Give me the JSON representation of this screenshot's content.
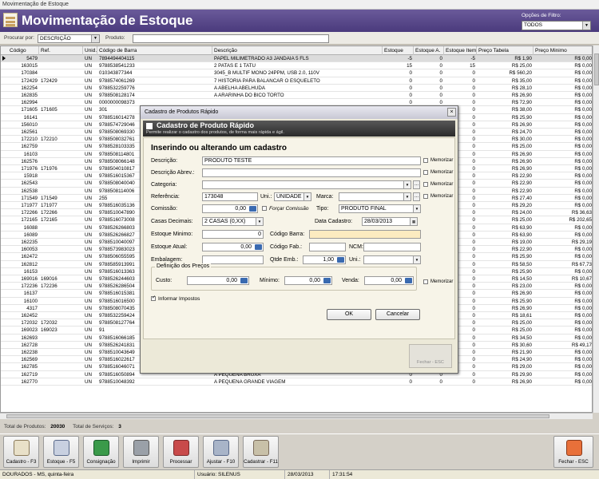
{
  "window": {
    "title": "Movimentação de Estoque"
  },
  "header": {
    "title": "Movimentação de Estoque",
    "filter_label": "Opções de Filtro:",
    "filter_value": "TODOS"
  },
  "search": {
    "by_label": "Procurar por:",
    "by_value": "DESCRIÇÃO",
    "product_label": "Produto:",
    "product_value": ""
  },
  "grid": {
    "columns": [
      "Código",
      "Ref.",
      "Unid.",
      "Código de Barra",
      "Descrição",
      "Estoque",
      "Estoque A.",
      "Estoque Item",
      "Preço Tabela",
      "Preço Minimo"
    ],
    "rows": [
      [
        "5479",
        "",
        "UN",
        "7894494404115",
        "PAPEL MILIMETRADO A3 JANDAIA 5 FLS",
        "-5",
        "0",
        "-5",
        "R$ 1,90",
        "R$ 0,00"
      ],
      [
        "163015",
        "",
        "UN",
        "9788538541233",
        "2 PATAS E 1 TATU",
        "15",
        "0",
        "15",
        "R$ 25,00",
        "R$ 0,00"
      ],
      [
        "170384",
        "",
        "UN",
        "010343877344",
        "3045_B MULTIF MONO 24PPM, USB 2.0, 110V",
        "0",
        "0",
        "0",
        "R$ 560,20",
        "R$ 0,00"
      ],
      [
        "172429",
        "172429",
        "UN",
        "9788574061269",
        "7 HISTORIA PARA BALANCAR O ESQUELETO",
        "0",
        "0",
        "0",
        "R$ 35,00",
        "R$ 0,00"
      ],
      [
        "162254",
        "",
        "UN",
        "9788532259776",
        "A ABELHA ABELHUDA",
        "0",
        "0",
        "0",
        "R$ 28,10",
        "R$ 0,00"
      ],
      [
        "162835",
        "",
        "UN",
        "9788508128174",
        "A ARARINHA DO BICO TORTO",
        "0",
        "0",
        "0",
        "R$ 26,90",
        "R$ 0,00"
      ],
      [
        "162994",
        "",
        "UN",
        "0000000098373",
        "",
        "0",
        "0",
        "0",
        "R$ 72,90",
        "R$ 0,00"
      ],
      [
        "171605",
        "171605",
        "UN",
        "301",
        "",
        "0",
        "0",
        "0",
        "R$ 38,00",
        "R$ 0,00"
      ],
      [
        "16141",
        "",
        "UN",
        "9788516014278",
        "",
        "0",
        "0",
        "0",
        "R$ 25,90",
        "R$ 0,00"
      ],
      [
        "156010",
        "",
        "UN",
        "9788574729046",
        "",
        "0",
        "0",
        "0",
        "R$ 26,90",
        "R$ 0,00"
      ],
      [
        "162561",
        "",
        "UN",
        "9788508069330",
        "",
        "0",
        "0",
        "0",
        "R$ 24,70",
        "R$ 0,00"
      ],
      [
        "172210",
        "172210",
        "UN",
        "9788508032761",
        "",
        "0",
        "0",
        "0",
        "R$ 30,00",
        "R$ 0,00"
      ],
      [
        "162759",
        "",
        "UN",
        "9788528103335",
        "",
        "0",
        "0",
        "0",
        "R$ 25,00",
        "R$ 0,00"
      ],
      [
        "16103",
        "",
        "UN",
        "9788508114801",
        "",
        "0",
        "0",
        "0",
        "R$ 26,90",
        "R$ 0,00"
      ],
      [
        "162576",
        "",
        "UN",
        "9788508066148",
        "",
        "0",
        "0",
        "0",
        "R$ 26,90",
        "R$ 0,00"
      ],
      [
        "171976",
        "171976",
        "UN",
        "9788504010817",
        "",
        "0",
        "0",
        "0",
        "R$ 26,90",
        "R$ 0,00"
      ],
      [
        "15918",
        "",
        "UN",
        "9788516015367",
        "",
        "0",
        "0",
        "0",
        "R$ 22,90",
        "R$ 0,00"
      ],
      [
        "162543",
        "",
        "UN",
        "9788508040040",
        "",
        "0",
        "0",
        "0",
        "R$ 22,90",
        "R$ 0,00"
      ],
      [
        "162538",
        "",
        "UN",
        "9788508114006",
        "",
        "0",
        "0",
        "0",
        "R$ 22,90",
        "R$ 0,00"
      ],
      [
        "171549",
        "171549",
        "UN",
        "255",
        "",
        "0",
        "0",
        "0",
        "R$ 27,40",
        "R$ 0,00"
      ],
      [
        "171977",
        "171977",
        "UN",
        "9788516035136",
        "",
        "0",
        "0",
        "0",
        "R$ 29,20",
        "R$ 0,00"
      ],
      [
        "172266",
        "172266",
        "UN",
        "9788510047890",
        "",
        "0",
        "0",
        "0",
        "R$ 24,00",
        "R$ 36,63"
      ],
      [
        "172165",
        "172165",
        "UN",
        "9788516073008",
        "",
        "0",
        "0",
        "0",
        "R$ 25,00",
        "R$ 202,65"
      ],
      [
        "16088",
        "",
        "UN",
        "9788526266803",
        "",
        "0",
        "0",
        "0",
        "R$ 63,90",
        "R$ 0,00"
      ],
      [
        "16089",
        "",
        "UN",
        "9788526266827",
        "",
        "0",
        "0",
        "0",
        "R$ 63,90",
        "R$ 0,00"
      ],
      [
        "162235",
        "",
        "UN",
        "9788510040097",
        "",
        "0",
        "0",
        "0",
        "R$ 19,00",
        "R$ 29,19"
      ],
      [
        "160053",
        "",
        "UN",
        "9788573983023",
        "",
        "0",
        "0",
        "0",
        "R$ 22,90",
        "R$ 0,00"
      ],
      [
        "162472",
        "",
        "UN",
        "9788506055595",
        "",
        "0",
        "0",
        "0",
        "R$ 25,90",
        "R$ 0,00"
      ],
      [
        "162812",
        "",
        "UN",
        "9788585913991",
        "",
        "0",
        "0",
        "0",
        "R$ 58,50",
        "R$ 67,73"
      ],
      [
        "16153",
        "",
        "UN",
        "9788516013363",
        "",
        "0",
        "0",
        "0",
        "R$ 25,90",
        "R$ 0,00"
      ],
      [
        "169016",
        "169016",
        "UN",
        "9788526244603",
        "",
        "0",
        "0",
        "0",
        "R$ 14,50",
        "R$ 10,67"
      ],
      [
        "172236",
        "172236",
        "UN",
        "9788526286504",
        "",
        "0",
        "0",
        "0",
        "R$ 23,00",
        "R$ 0,00"
      ],
      [
        "16137",
        "",
        "UN",
        "9788516015381",
        "",
        "0",
        "0",
        "0",
        "R$ 26,90",
        "R$ 0,00"
      ],
      [
        "16100",
        "",
        "UN",
        "9788516016500",
        "",
        "0",
        "0",
        "0",
        "R$ 25,90",
        "R$ 0,00"
      ],
      [
        "4317",
        "",
        "UN",
        "9788508070435",
        "",
        "0",
        "0",
        "0",
        "R$ 26,90",
        "R$ 0,00"
      ],
      [
        "162452",
        "",
        "UN",
        "9788532259424",
        "",
        "0",
        "0",
        "0",
        "R$ 18,61",
        "R$ 0,00"
      ],
      [
        "172032",
        "172032",
        "UN",
        "9788508127764",
        "",
        "0",
        "0",
        "0",
        "R$ 25,00",
        "R$ 0,00"
      ],
      [
        "169023",
        "169023",
        "UN",
        "91",
        "",
        "0",
        "0",
        "0",
        "R$ 25,00",
        "R$ 0,00"
      ],
      [
        "162693",
        "",
        "UN",
        "9788516066185",
        "",
        "0",
        "0",
        "0",
        "R$ 34,50",
        "R$ 0,00"
      ],
      [
        "162728",
        "",
        "UN",
        "9788526241831",
        "",
        "0",
        "0",
        "0",
        "R$ 30,60",
        "R$ 49,17"
      ],
      [
        "162238",
        "",
        "UN",
        "9788510043649",
        "A MINHOCA FILOMENA",
        "0",
        "0",
        "0",
        "R$ 21,90",
        "R$ 0,00"
      ],
      [
        "162569",
        "",
        "UN",
        "9788516022617",
        "A NOVELA DA PANELA",
        "0",
        "0",
        "0",
        "R$ 24,90",
        "R$ 0,00"
      ],
      [
        "162785",
        "",
        "UN",
        "9788516046071",
        "A ORQUESTRA TIM TIM POR TIM TIM",
        "0",
        "0",
        "0",
        "R$ 29,00",
        "R$ 0,00"
      ],
      [
        "162719",
        "",
        "UN",
        "9788516050894",
        "A PEQUENA BRUXA",
        "0",
        "0",
        "0",
        "R$ 29,90",
        "R$ 0,00"
      ],
      [
        "162770",
        "",
        "UN",
        "9788510048392",
        "A PEQUENA GRANDE VIAGEM",
        "0",
        "0",
        "0",
        "R$ 26,90",
        "R$ 0,00"
      ]
    ]
  },
  "totals": {
    "produtos_label": "Total de Produtos:",
    "produtos_value": "20030",
    "servicos_label": "Total de Serviços:",
    "servicos_value": "3"
  },
  "toolbar": {
    "cadastro": "Cadastro - F3",
    "estoque": "Estoque - F5",
    "consignacao": "Consignação",
    "imprimir": "Imprimir",
    "processar": "Processar",
    "ajustar": "Ajustar - F10",
    "cadastrar": "Cadastrar - F11",
    "fechar": "Fechar - ESC"
  },
  "statusbar": {
    "location": "DOURADOS - MS, quinta-feira",
    "user": "Usuário: SILENUS",
    "date": "28/03/2013",
    "time": "17:31:54"
  },
  "modal": {
    "window_title": "Cadastro de Produtos Rápido",
    "banner_title": "Cadastro de Produto Rápido",
    "banner_subtitle": "Permite realizar o cadastro dos produtos, de forma mais rápida e ágil.",
    "section_title": "Inserindo ou alterando um cadastro",
    "memorizar": "Memorizar",
    "fields": {
      "descricao_label": "Descrição:",
      "descricao_value": "PRODUTO TESTE",
      "descricao_abrev_label": "Descrição Abrev.:",
      "descricao_abrev_value": "",
      "categoria_label": "Categoria:",
      "categoria_value": "",
      "referencia_label": "Referência:",
      "referencia_value": "173048",
      "uni_label": "Uni.:",
      "uni_value": "UNIDADE",
      "marca_label": "Marca:",
      "marca_value": "",
      "comissao_label": "Comissão:",
      "comissao_value": "0,00",
      "forcar_comissao_label": "Forçar Comissão",
      "tipo_label": "Tipo:",
      "tipo_value": "PRODUTO FINAL",
      "casas_decimais_label": "Casas Decimais:",
      "casas_decimais_value": "2 CASAS (0,XX)",
      "data_cadastro_label": "Data Cadastro:",
      "data_cadastro_value": "28/03/2013",
      "estoque_minimo_label": "Estoque Minimo:",
      "estoque_minimo_value": "0",
      "codigo_barra_label": "Código Barra:",
      "codigo_barra_value": "",
      "estoque_atual_label": "Estoque Atual:",
      "estoque_atual_value": "0,00",
      "codigo_fab_label": "Código Fab.:",
      "codigo_fab_value": "",
      "ncm_label": "NCM:",
      "ncm_value": "",
      "embalagem_label": "Embalagem:",
      "embalagem_value": "",
      "qtde_emb_label": "Qtde Emb.:",
      "qtde_emb_value": "1,00",
      "uni2_label": "Uni.:",
      "uni2_value": ""
    },
    "precos": {
      "legend": "Definição dos Preços",
      "custo_label": "Custo:",
      "custo_value": "0,00",
      "minimo_label": "Mínimo:",
      "minimo_value": "0,00",
      "venda_label": "Venda:",
      "venda_value": "0,00"
    },
    "informar_impostos": "Informar Impostos",
    "ok": "OK",
    "cancelar": "Cancelar",
    "fechar": "Fechar - ESC"
  },
  "colors": {
    "header_bg": "#4a3a7c",
    "banner_bg": "#2a2a2a",
    "yellow_field": "#fcebc0",
    "spin_blue": "#3a6ab0"
  }
}
